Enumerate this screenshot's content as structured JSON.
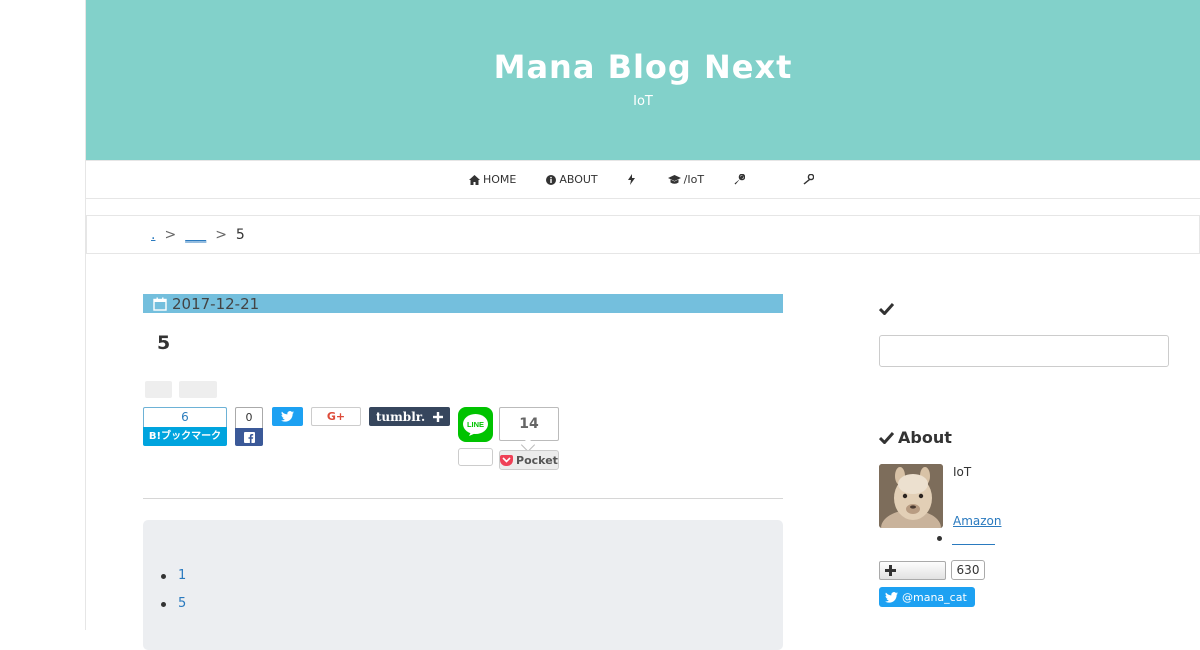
{
  "header": {
    "title": "Mana Blog Next",
    "description": "IoT"
  },
  "nav": {
    "items": [
      {
        "label": "HOME",
        "icon": "home-icon"
      },
      {
        "label": "ABOUT",
        "icon": "info-icon"
      },
      {
        "label": "",
        "icon": "bolt-icon"
      },
      {
        "label": "/IoT",
        "icon": "graduation-cap-icon"
      },
      {
        "label": "",
        "icon": "wrench-icon"
      },
      {
        "label": "",
        "icon": "wrench-icon"
      }
    ]
  },
  "breadcrumb": {
    "home": ".",
    "category": "___",
    "separator": ">",
    "current": "5"
  },
  "post": {
    "date": "2017-12-21",
    "title": "5"
  },
  "share": {
    "hatena_count": "6",
    "hatena_label": "B!ブックマーク",
    "facebook_count": "0",
    "google_label": "G+",
    "tumblr_label": "tumblr.",
    "line_label": "LINE",
    "line_count": "",
    "pocket_count": "14",
    "pocket_label": "Pocket"
  },
  "toc": {
    "items": [
      "1",
      "5"
    ]
  },
  "sidebar": {
    "about_title": "About",
    "about_text": "IoT",
    "about_link": "Amazon",
    "follow_count": "630",
    "twitter_handle": "@mana_cat"
  },
  "colors": {
    "header_bg": "#82d1ca",
    "date_bar": "#74bfdd",
    "link": "#2a7abf",
    "twitter": "#1da1f2",
    "hatena": "#00a4de",
    "facebook": "#3b5998",
    "tumblr": "#36465d",
    "line": "#00c300",
    "pocket": "#ef4056"
  }
}
